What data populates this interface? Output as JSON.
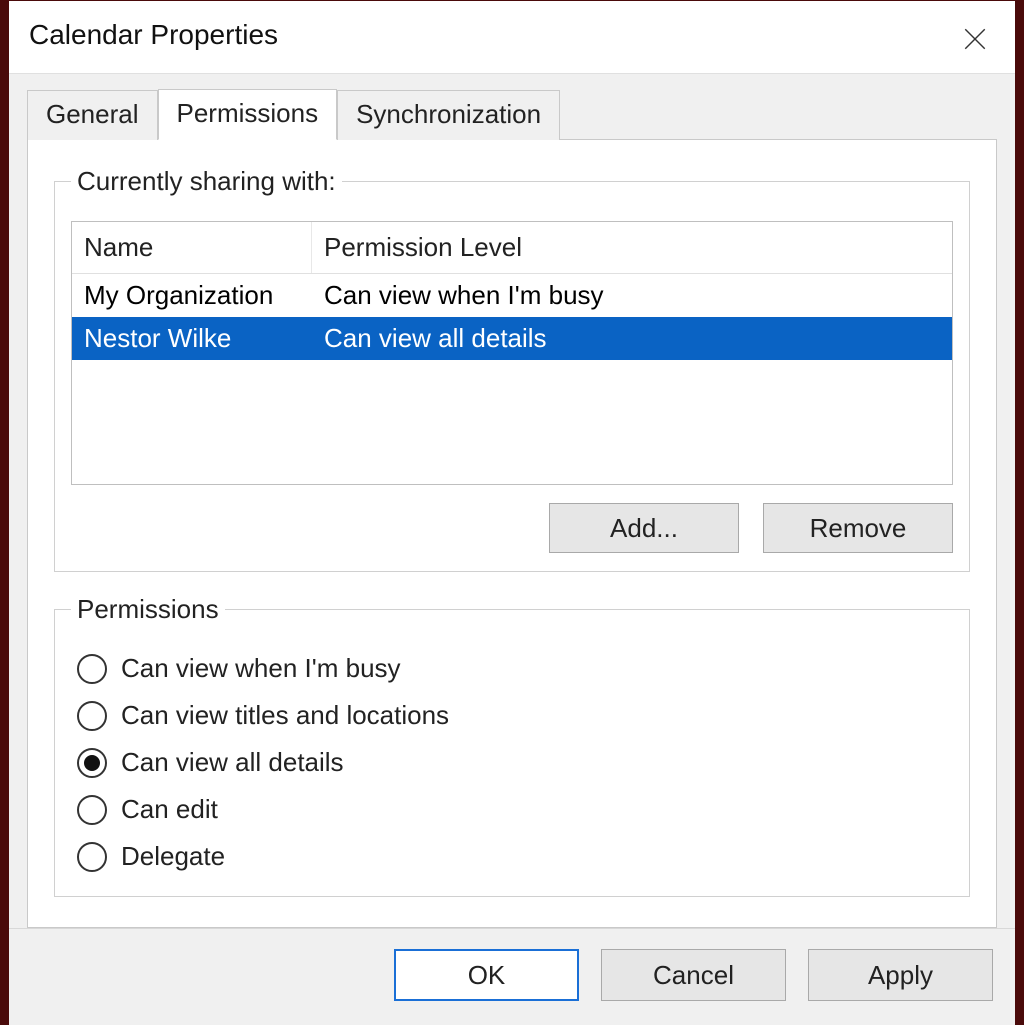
{
  "window": {
    "title": "Calendar Properties"
  },
  "tabs": [
    {
      "label": "General",
      "active": false
    },
    {
      "label": "Permissions",
      "active": true
    },
    {
      "label": "Synchronization",
      "active": false
    }
  ],
  "sharing": {
    "legend": "Currently sharing with:",
    "columns": {
      "name": "Name",
      "permission": "Permission Level"
    },
    "rows": [
      {
        "name": "My Organization",
        "permission": "Can view when I'm busy",
        "selected": false
      },
      {
        "name": "Nestor Wilke",
        "permission": "Can view all details",
        "selected": true
      }
    ],
    "add_label": "Add...",
    "remove_label": "Remove"
  },
  "permissions": {
    "legend": "Permissions",
    "options": [
      {
        "label": "Can view when I'm busy",
        "checked": false
      },
      {
        "label": "Can view titles and locations",
        "checked": false
      },
      {
        "label": "Can view all details",
        "checked": true
      },
      {
        "label": "Can edit",
        "checked": false
      },
      {
        "label": "Delegate",
        "checked": false
      }
    ]
  },
  "footer": {
    "ok": "OK",
    "cancel": "Cancel",
    "apply": "Apply"
  }
}
